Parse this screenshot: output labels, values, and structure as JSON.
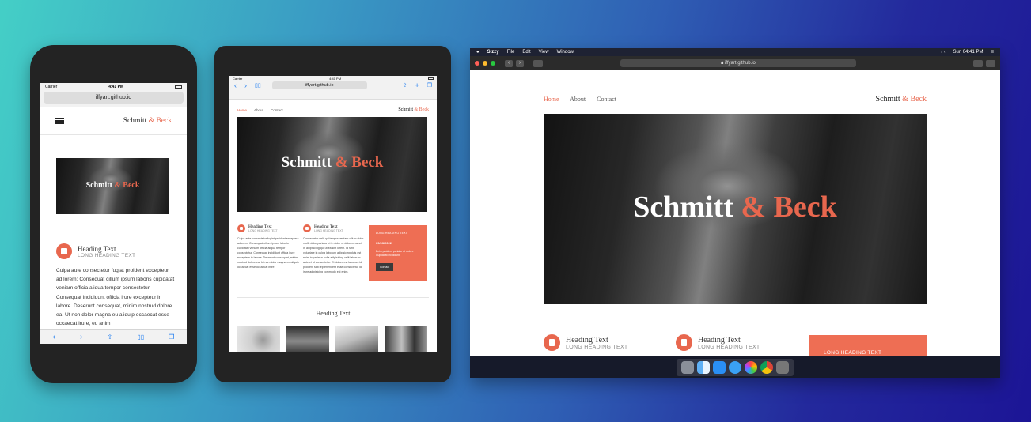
{
  "brand": {
    "name_part1": "Schmitt",
    "name_part2": "& Beck"
  },
  "url": "iffyart.github.io",
  "nav": {
    "home": "Home",
    "about": "About",
    "contact": "Contact"
  },
  "heading": {
    "title": "Heading Text",
    "subtitle": "LONG HEADING TEXT"
  },
  "body_text": "Culpa aute consectetur fugiat proident excepteur ad lorem: Consequat cillum ipsum laboris cupidatat veniam officia aliqua tempor consectetur. Consequat incididunt officia irure excepteur in labore. Deserunt consequat, minim nostrud dolore ea. Ut non dolor magna eu aliquip occaecat esse occaecat irure, eu anim",
  "phone": {
    "carrier": "Carrier",
    "time": "4:41 PM"
  },
  "tablet": {
    "carrier": "Carrier",
    "time": "4:41 PM",
    "col1_text": "Culpa aute consectetur fugiat proident excepteur adlorem: Consequat cillum ipsum laboris cupidatat veniam officia aliqua tempor consectetur. Consequat incididunt officia irure excepteur in labore. Deserunt consequat, minim nostrud dolore ea. Ut non dolor magna eu aliquip occaecat esse occaecat irure",
    "col2_text": "Consectetur velit qui tempor veniam cillum dolor mollit dolor pariatur et in dolor et dolor eu amet. In adipisicing qui ut ea sint lorem. Id sint voluptate in culpa laborum adipisicing duis est enim in pariatur nulla adipisicing velit laborum aute et id consectetur. Et dolore est laborum id proident sint reprehenderit esse consectetur id irure adipisicing commodo est enim.",
    "card_label": "LONG HEADING TEXT",
    "card_date": "09/03/2022",
    "card_text": "Enim proident pariatur et dolore Cupidatat incididunt.",
    "card_button": "Contact",
    "section_heading": "Heading Text"
  },
  "mac": {
    "app": "Sizzy",
    "menu": [
      "File",
      "Edit",
      "View",
      "Window"
    ],
    "clock": "Sun 04:41 PM",
    "card_label": "LONG HEADING TEXT"
  },
  "colors": {
    "accent": "#e8674e",
    "dark": "#232323"
  },
  "icons": [
    "hamburger-icon",
    "book-icon",
    "back-icon",
    "forward-icon",
    "share-icon",
    "bookmarks-icon",
    "tabs-icon",
    "plus-icon",
    "lock-icon",
    "sidebar-icon",
    "apple-icon",
    "wifi-icon",
    "battery-icon"
  ]
}
